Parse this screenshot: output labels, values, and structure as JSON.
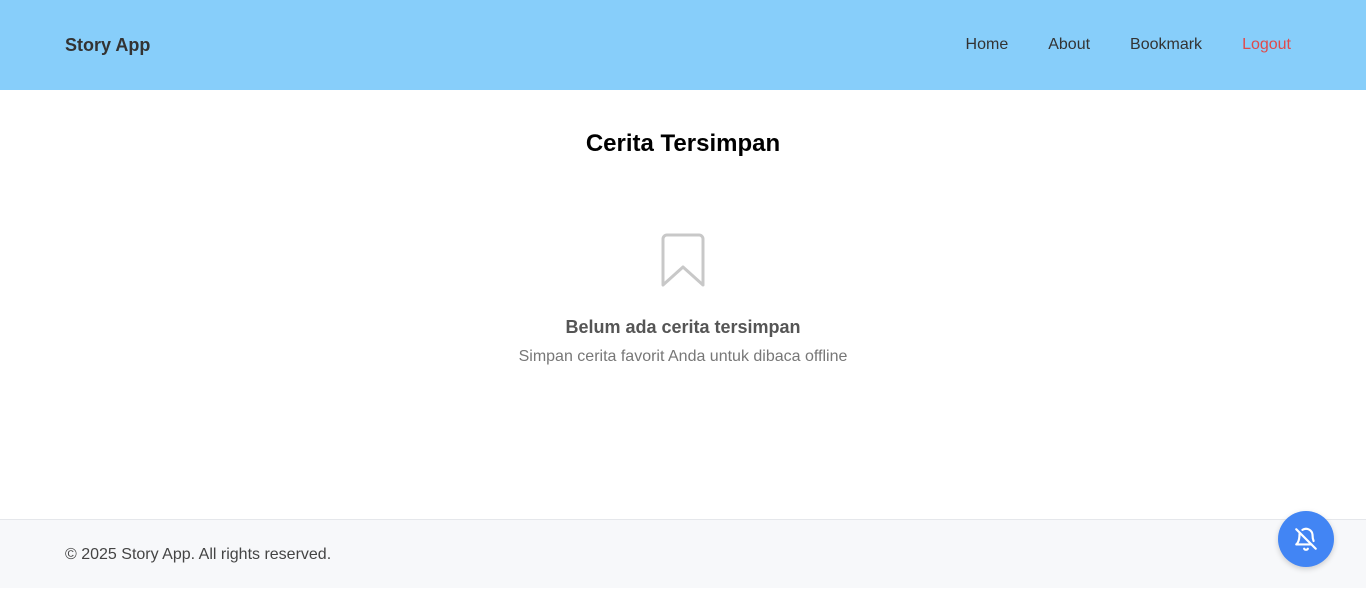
{
  "header": {
    "brand": "Story App",
    "nav": {
      "home": "Home",
      "about": "About",
      "bookmark": "Bookmark",
      "logout": "Logout"
    },
    "colors": {
      "background": "#87cefa",
      "logout": "#e04a4a"
    }
  },
  "main": {
    "title": "Cerita Tersimpan",
    "empty_state": {
      "icon": "bookmark-icon",
      "title": "Belum ada cerita tersimpan",
      "subtitle": "Simpan cerita favorit Anda untuk dibaca offline"
    }
  },
  "footer": {
    "copyright": "© 2025 Story App. All rights reserved."
  },
  "fab": {
    "icon": "bell-off-icon",
    "color": "#4285f4"
  }
}
